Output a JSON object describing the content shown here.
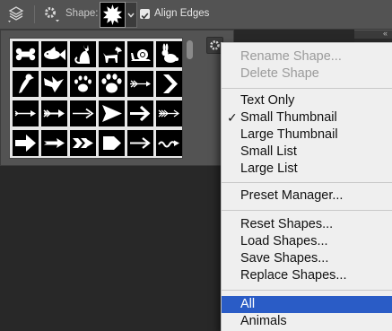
{
  "options_bar": {
    "shape_label": "Shape:",
    "align_edges_label": "Align Edges",
    "align_edges_checked": true
  },
  "shape_grid": {
    "rows": [
      [
        "bone-icon",
        "fish-icon",
        "cat-icon",
        "dog-icon",
        "snail-icon",
        "rabbit-icon"
      ],
      [
        "parrot-icon",
        "bird-icon",
        "paw-print-icon",
        "paw-print-large-icon",
        "feathered-arrow-icon",
        "chevron-right-icon"
      ],
      [
        "arrow-thin-icon",
        "arrow-fletched-icon",
        "arrow-long-icon",
        "arrow-wedge-icon",
        "arrow-bold-icon",
        "arrow-feather-icon"
      ],
      [
        "arrow-block-icon",
        "arrow-narrow-icon",
        "arrow-double-icon",
        "arrow-pentagon-icon",
        "arrow-plain-icon",
        "arrow-wavy-icon"
      ]
    ]
  },
  "menu": {
    "items": [
      {
        "label": "Rename Shape...",
        "disabled": true
      },
      {
        "label": "Delete Shape",
        "disabled": true
      },
      {
        "label": "Text Only"
      },
      {
        "label": "Small Thumbnail",
        "checked": true
      },
      {
        "label": "Large Thumbnail"
      },
      {
        "label": "Small List"
      },
      {
        "label": "Large List"
      },
      {
        "label": "Preset Manager..."
      },
      {
        "label": "Reset Shapes..."
      },
      {
        "label": "Load Shapes..."
      },
      {
        "label": "Save Shapes..."
      },
      {
        "label": "Replace Shapes..."
      },
      {
        "label": "All",
        "selected": true
      },
      {
        "label": "Animals"
      }
    ],
    "check_glyph": "✓"
  },
  "colors": {
    "toolbar_bg": "#535353",
    "menu_bg": "#efefef",
    "menu_selected": "#2a5cc6",
    "workspace": "#282828"
  }
}
